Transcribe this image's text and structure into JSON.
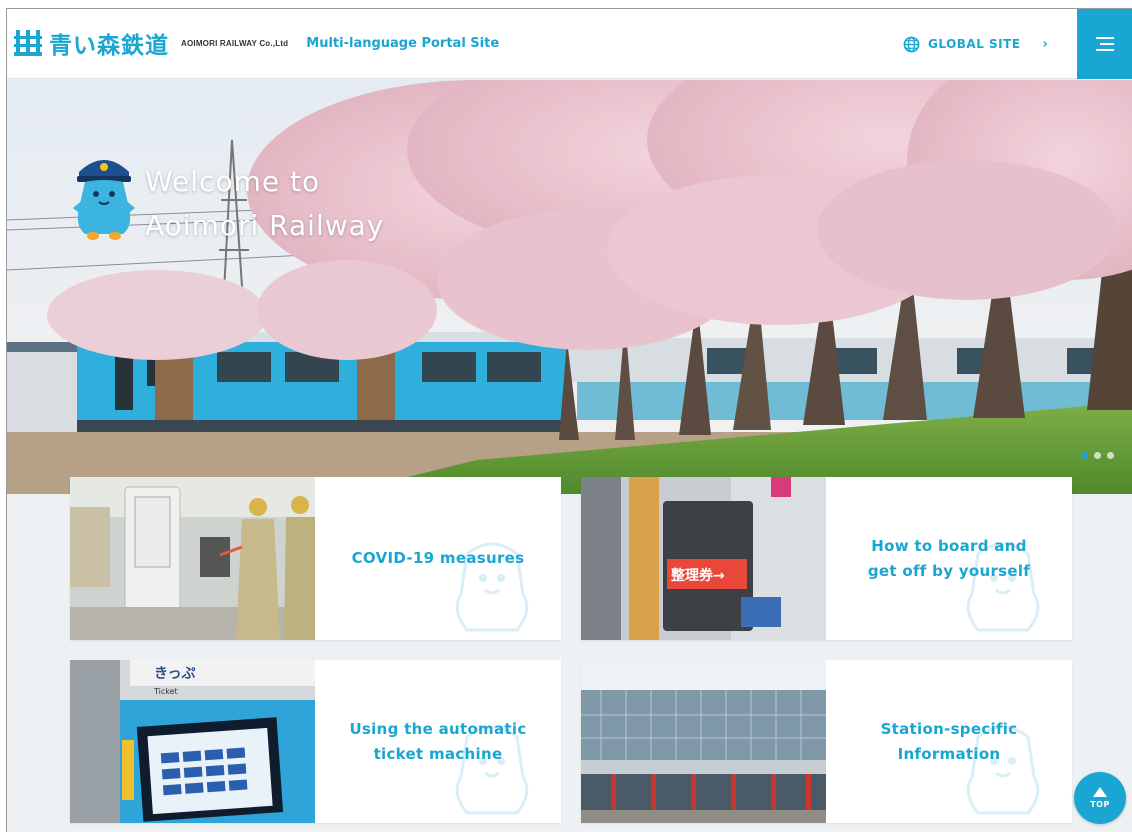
{
  "header": {
    "logo_jp": [
      "青い",
      "森",
      "鉄道"
    ],
    "logo_en": "AOIMORI RAILWAY Co.,Ltd",
    "portal_title": "Multi-language Portal Site",
    "global_label": "GLOBAL SITE",
    "global_chevron": "›",
    "menu_icon": "hamburger-icon"
  },
  "hero": {
    "welcome_line1": "Welcome to",
    "welcome_line2": "Aoimori Railway",
    "slide_count": 3,
    "active_slide": 1
  },
  "cards": [
    {
      "label_line1": "COVID-19 measures",
      "label_line2": ""
    },
    {
      "label_line1": "How to board and",
      "label_line2": "get off by yourself",
      "sign_text": "整理券→"
    },
    {
      "label_line1": "Using the automatic",
      "label_line2": "ticket machine",
      "sign_text": "きっぷ",
      "sign_sub": "Ticket"
    },
    {
      "label_line1": "Station-specific",
      "label_line2": "Information"
    }
  ],
  "top_button": {
    "label": "TOP"
  },
  "colors": {
    "accent": "#1aa6d2",
    "blossom": "#e9c6cf",
    "grass": "#5f9a3a"
  }
}
